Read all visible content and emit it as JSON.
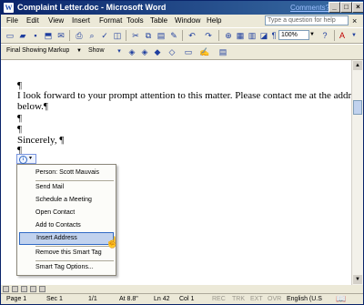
{
  "window": {
    "title": "Complaint Letter.doc - Microsoft Word",
    "app_icon": "W",
    "comments_link": "Comments?",
    "minimize_icon": "_",
    "maximize_icon": "□",
    "close_icon": "×"
  },
  "menubar": {
    "items": [
      "File",
      "Edit",
      "View",
      "Insert",
      "Format",
      "Tools",
      "Table",
      "Window",
      "Help"
    ],
    "help_placeholder": "Type a question for help",
    "doc_close_icon": "×"
  },
  "toolbar": {
    "zoom": "100%",
    "icons": [
      "new-icon",
      "open-icon",
      "save-icon",
      "permission-icon",
      "email-icon",
      "print-icon",
      "print-preview-icon",
      "spelling-icon",
      "research-icon",
      "cut-icon",
      "copy-icon",
      "paste-icon",
      "format-painter-icon",
      "undo-icon",
      "redo-icon",
      "hyperlink-icon",
      "tables-borders-icon",
      "insert-table-icon",
      "insert-excel-icon",
      "columns-icon",
      "drawing-icon",
      "document-map-icon",
      "show-hide-icon",
      "help-icon",
      "font-color-icon"
    ]
  },
  "reviewing": {
    "markup": "Final Showing Markup",
    "show": "Show"
  },
  "document": {
    "lines": [
      "¶",
      "I look forward to your prompt attention to this matter. Please contact me at the address",
      "below.¶",
      "¶",
      "¶",
      "Sincerely, ¶",
      "¶"
    ]
  },
  "smart_tag_menu": {
    "items": [
      "Person: Scott Mauvais",
      "Send Mail",
      "Schedule a Meeting",
      "Open Contact",
      "Add to Contacts",
      "Insert Address",
      "Remove this Smart Tag",
      "Smart Tag Options..."
    ],
    "highlighted_index": 5
  },
  "statusbar": {
    "page": "Page 1",
    "section": "Sec 1",
    "pages": "1/1",
    "at": "At 8.8\"",
    "line": "Ln 42",
    "col": "Col 1",
    "rec": "REC",
    "trk": "TRK",
    "ext": "EXT",
    "ovr": "OVR",
    "language": "English (U.S"
  },
  "colors": {
    "titlebar": "#0a246a",
    "chrome": "#ece9d8",
    "highlight": "#c1d2ee"
  }
}
